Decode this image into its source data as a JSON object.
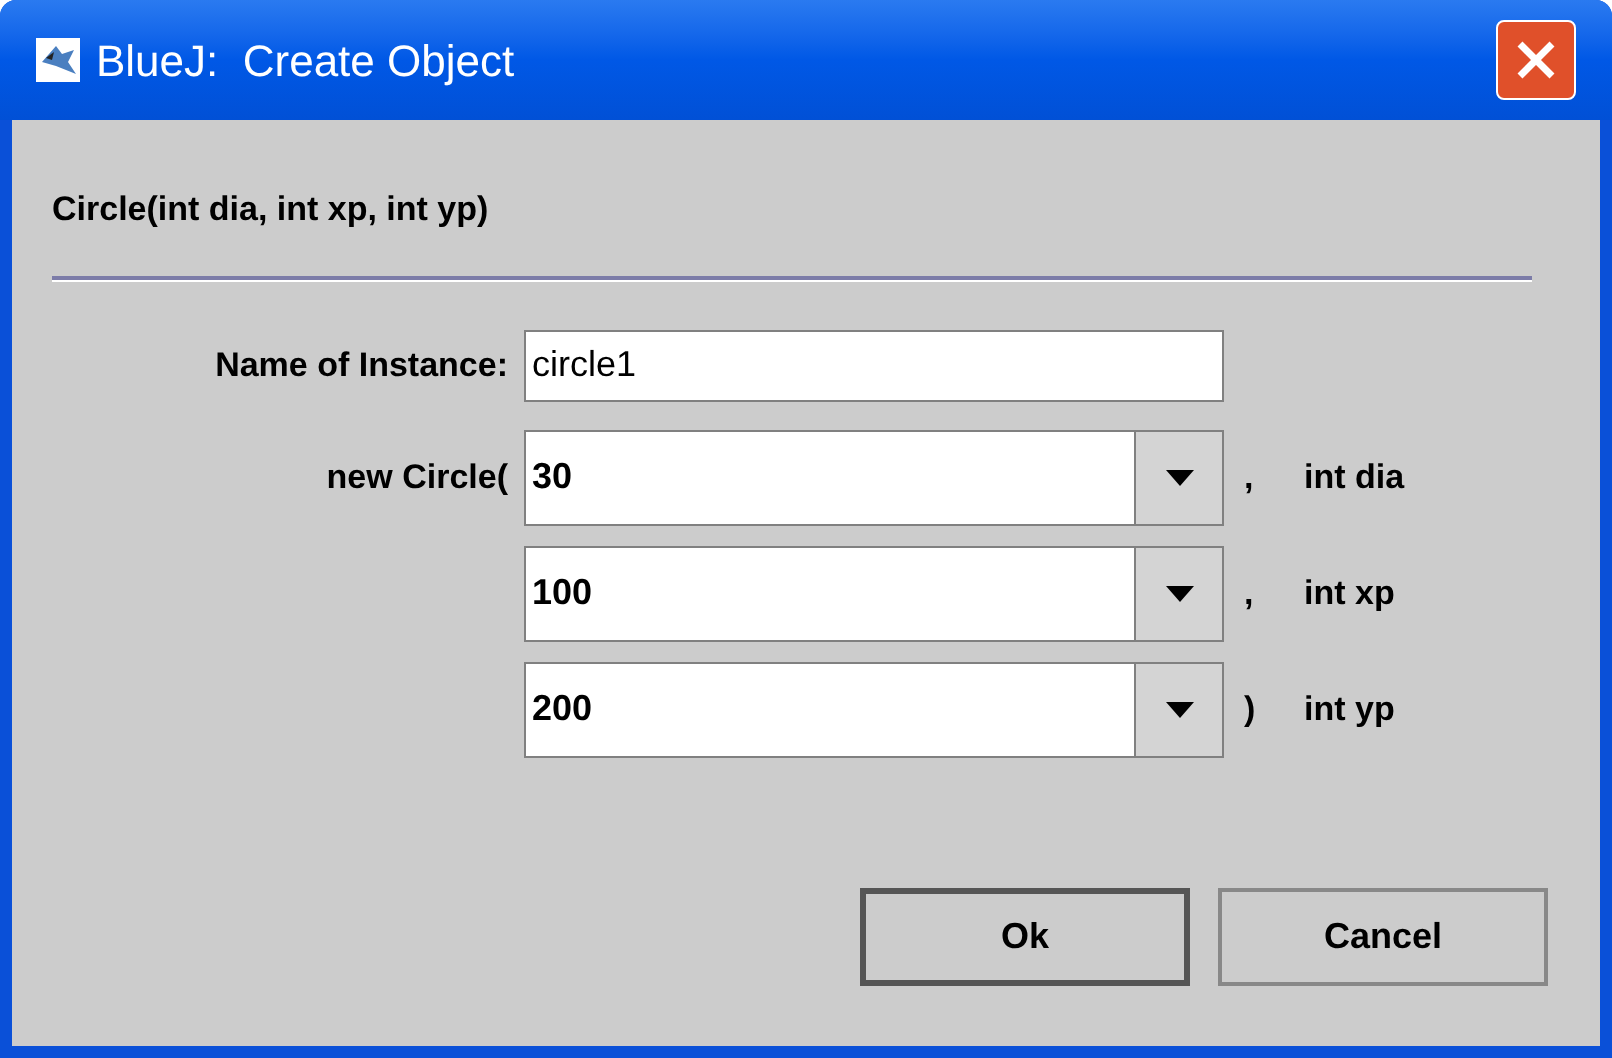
{
  "window": {
    "title": "BlueJ:  Create Object"
  },
  "signature": "Circle(int dia, int xp, int yp)",
  "instance": {
    "label": "Name of Instance:",
    "value": "circle1"
  },
  "constructor_label": "new Circle(",
  "parameters": [
    {
      "value": "30",
      "separator": ",",
      "type": "int dia"
    },
    {
      "value": "100",
      "separator": ",",
      "type": "int xp"
    },
    {
      "value": "200",
      "separator": ")",
      "type": "int yp"
    }
  ],
  "buttons": [
    {
      "label": "Ok",
      "default": true
    },
    {
      "label": "Cancel",
      "default": false
    }
  ]
}
